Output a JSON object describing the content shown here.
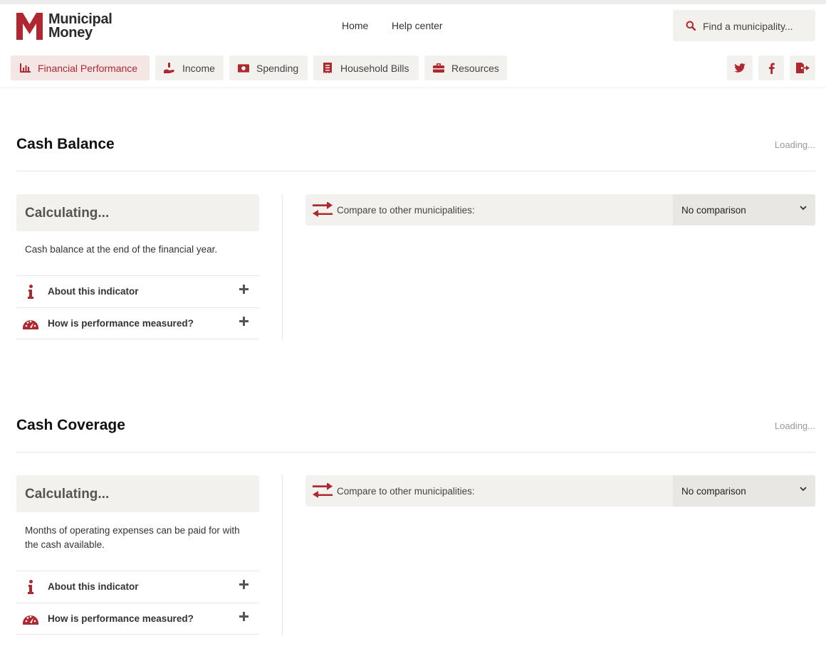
{
  "brand": {
    "logo_line1": "Municipal",
    "logo_line2": "Money",
    "accent": "#b0282f"
  },
  "header": {
    "nav": [
      "Home",
      "Help center"
    ],
    "search_placeholder": "Find a municipality..."
  },
  "tabs": [
    {
      "label": "Financial Performance",
      "icon": "chart-bar-icon",
      "active": true
    },
    {
      "label": "Income",
      "icon": "hand-holding-dollar-icon",
      "active": false
    },
    {
      "label": "Spending",
      "icon": "money-bill-icon",
      "active": false
    },
    {
      "label": "Household Bills",
      "icon": "receipt-icon",
      "active": false
    },
    {
      "label": "Resources",
      "icon": "toolbox-icon",
      "active": false
    }
  ],
  "share_icons": [
    "twitter-icon",
    "facebook-icon",
    "export-icon"
  ],
  "sections": [
    {
      "title": "Cash Balance",
      "status": "Loading...",
      "calc_text": "Calculating...",
      "description": "Cash balance at the end of the financial year.",
      "accordions": [
        "About this indicator",
        "How is performance measured?"
      ],
      "compare_label": "Compare to other municipalities:",
      "compare_value": "No comparison"
    },
    {
      "title": "Cash Coverage",
      "status": "Loading...",
      "calc_text": "Calculating...",
      "description": "Months of operating expenses can be paid for with the cash available.",
      "accordions": [
        "About this indicator",
        "How is performance measured?"
      ],
      "compare_label": "Compare to other municipalities:",
      "compare_value": "No comparison"
    }
  ]
}
